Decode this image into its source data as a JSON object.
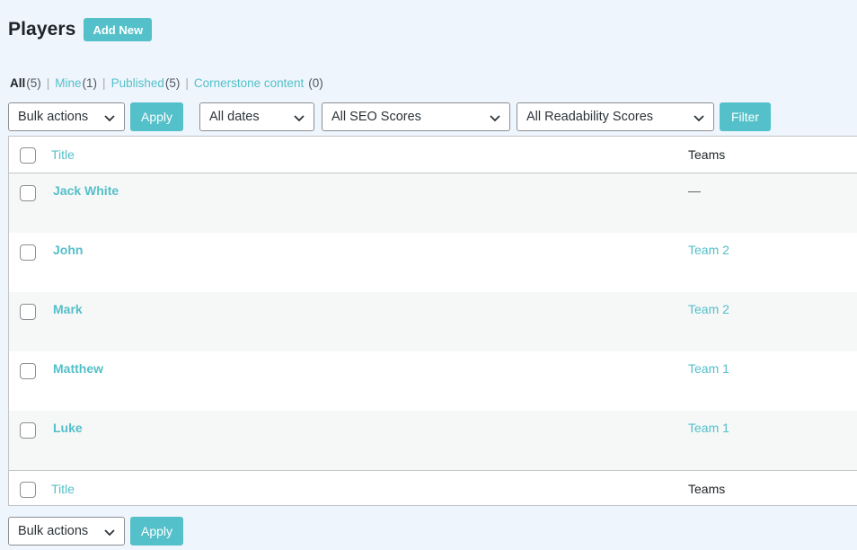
{
  "header": {
    "title": "Players",
    "add_new": "Add New"
  },
  "views": [
    {
      "label": "All",
      "count": "(5)",
      "current": true
    },
    {
      "label": "Mine",
      "count": "(1)"
    },
    {
      "label": "Published",
      "count": "(5)"
    },
    {
      "label": "Cornerstone content",
      "count": "(0)"
    }
  ],
  "filters": {
    "bulk_actions": "Bulk actions",
    "apply": "Apply",
    "dates": "All dates",
    "seo": "All SEO Scores",
    "readability": "All Readability Scores",
    "filter": "Filter"
  },
  "table": {
    "columns": {
      "title": "Title",
      "teams": "Teams"
    },
    "rows": [
      {
        "title": "Jack White",
        "team": "—"
      },
      {
        "title": "John",
        "team": "Team 2"
      },
      {
        "title": "Mark",
        "team": "Team 2"
      },
      {
        "title": "Matthew",
        "team": "Team 1"
      },
      {
        "title": "Luke",
        "team": "Team 1"
      }
    ]
  },
  "bottom": {
    "bulk_actions": "Bulk actions",
    "apply": "Apply"
  }
}
